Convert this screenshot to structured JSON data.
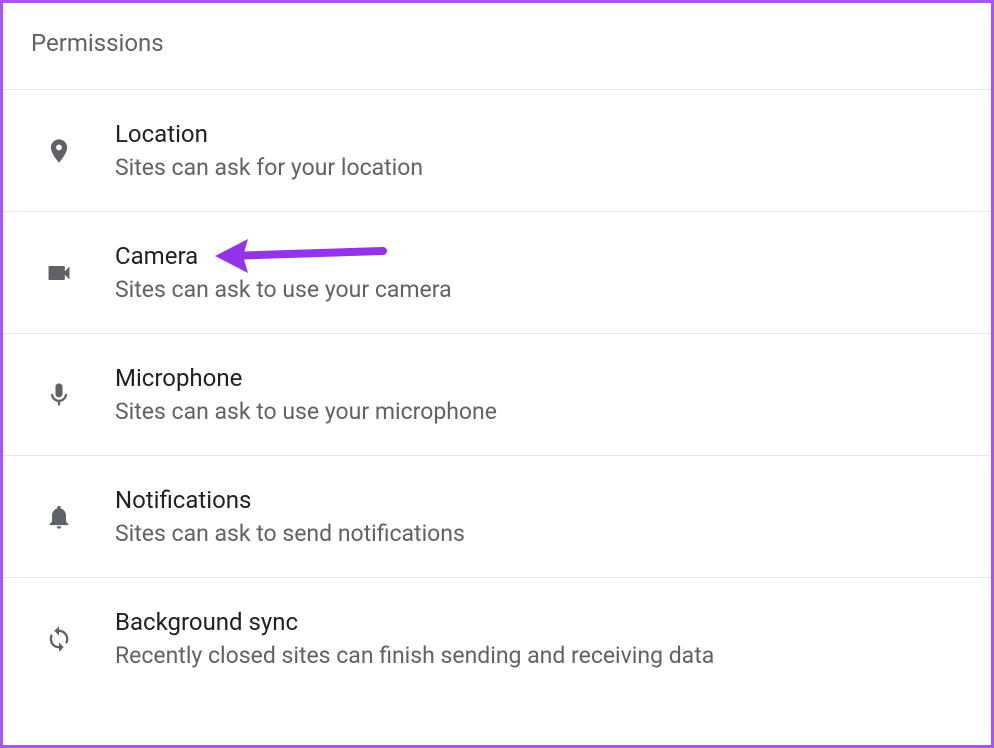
{
  "header": {
    "title": "Permissions"
  },
  "permissions": [
    {
      "icon": "location",
      "title": "Location",
      "description": "Sites can ask for your location"
    },
    {
      "icon": "camera",
      "title": "Camera",
      "description": "Sites can ask to use your camera"
    },
    {
      "icon": "microphone",
      "title": "Microphone",
      "description": "Sites can ask to use your microphone"
    },
    {
      "icon": "notifications",
      "title": "Notifications",
      "description": "Sites can ask to send notifications"
    },
    {
      "icon": "sync",
      "title": "Background sync",
      "description": "Recently closed sites can finish sending and receiving data"
    }
  ],
  "annotation": {
    "target": "camera",
    "color": "#9333ea"
  }
}
